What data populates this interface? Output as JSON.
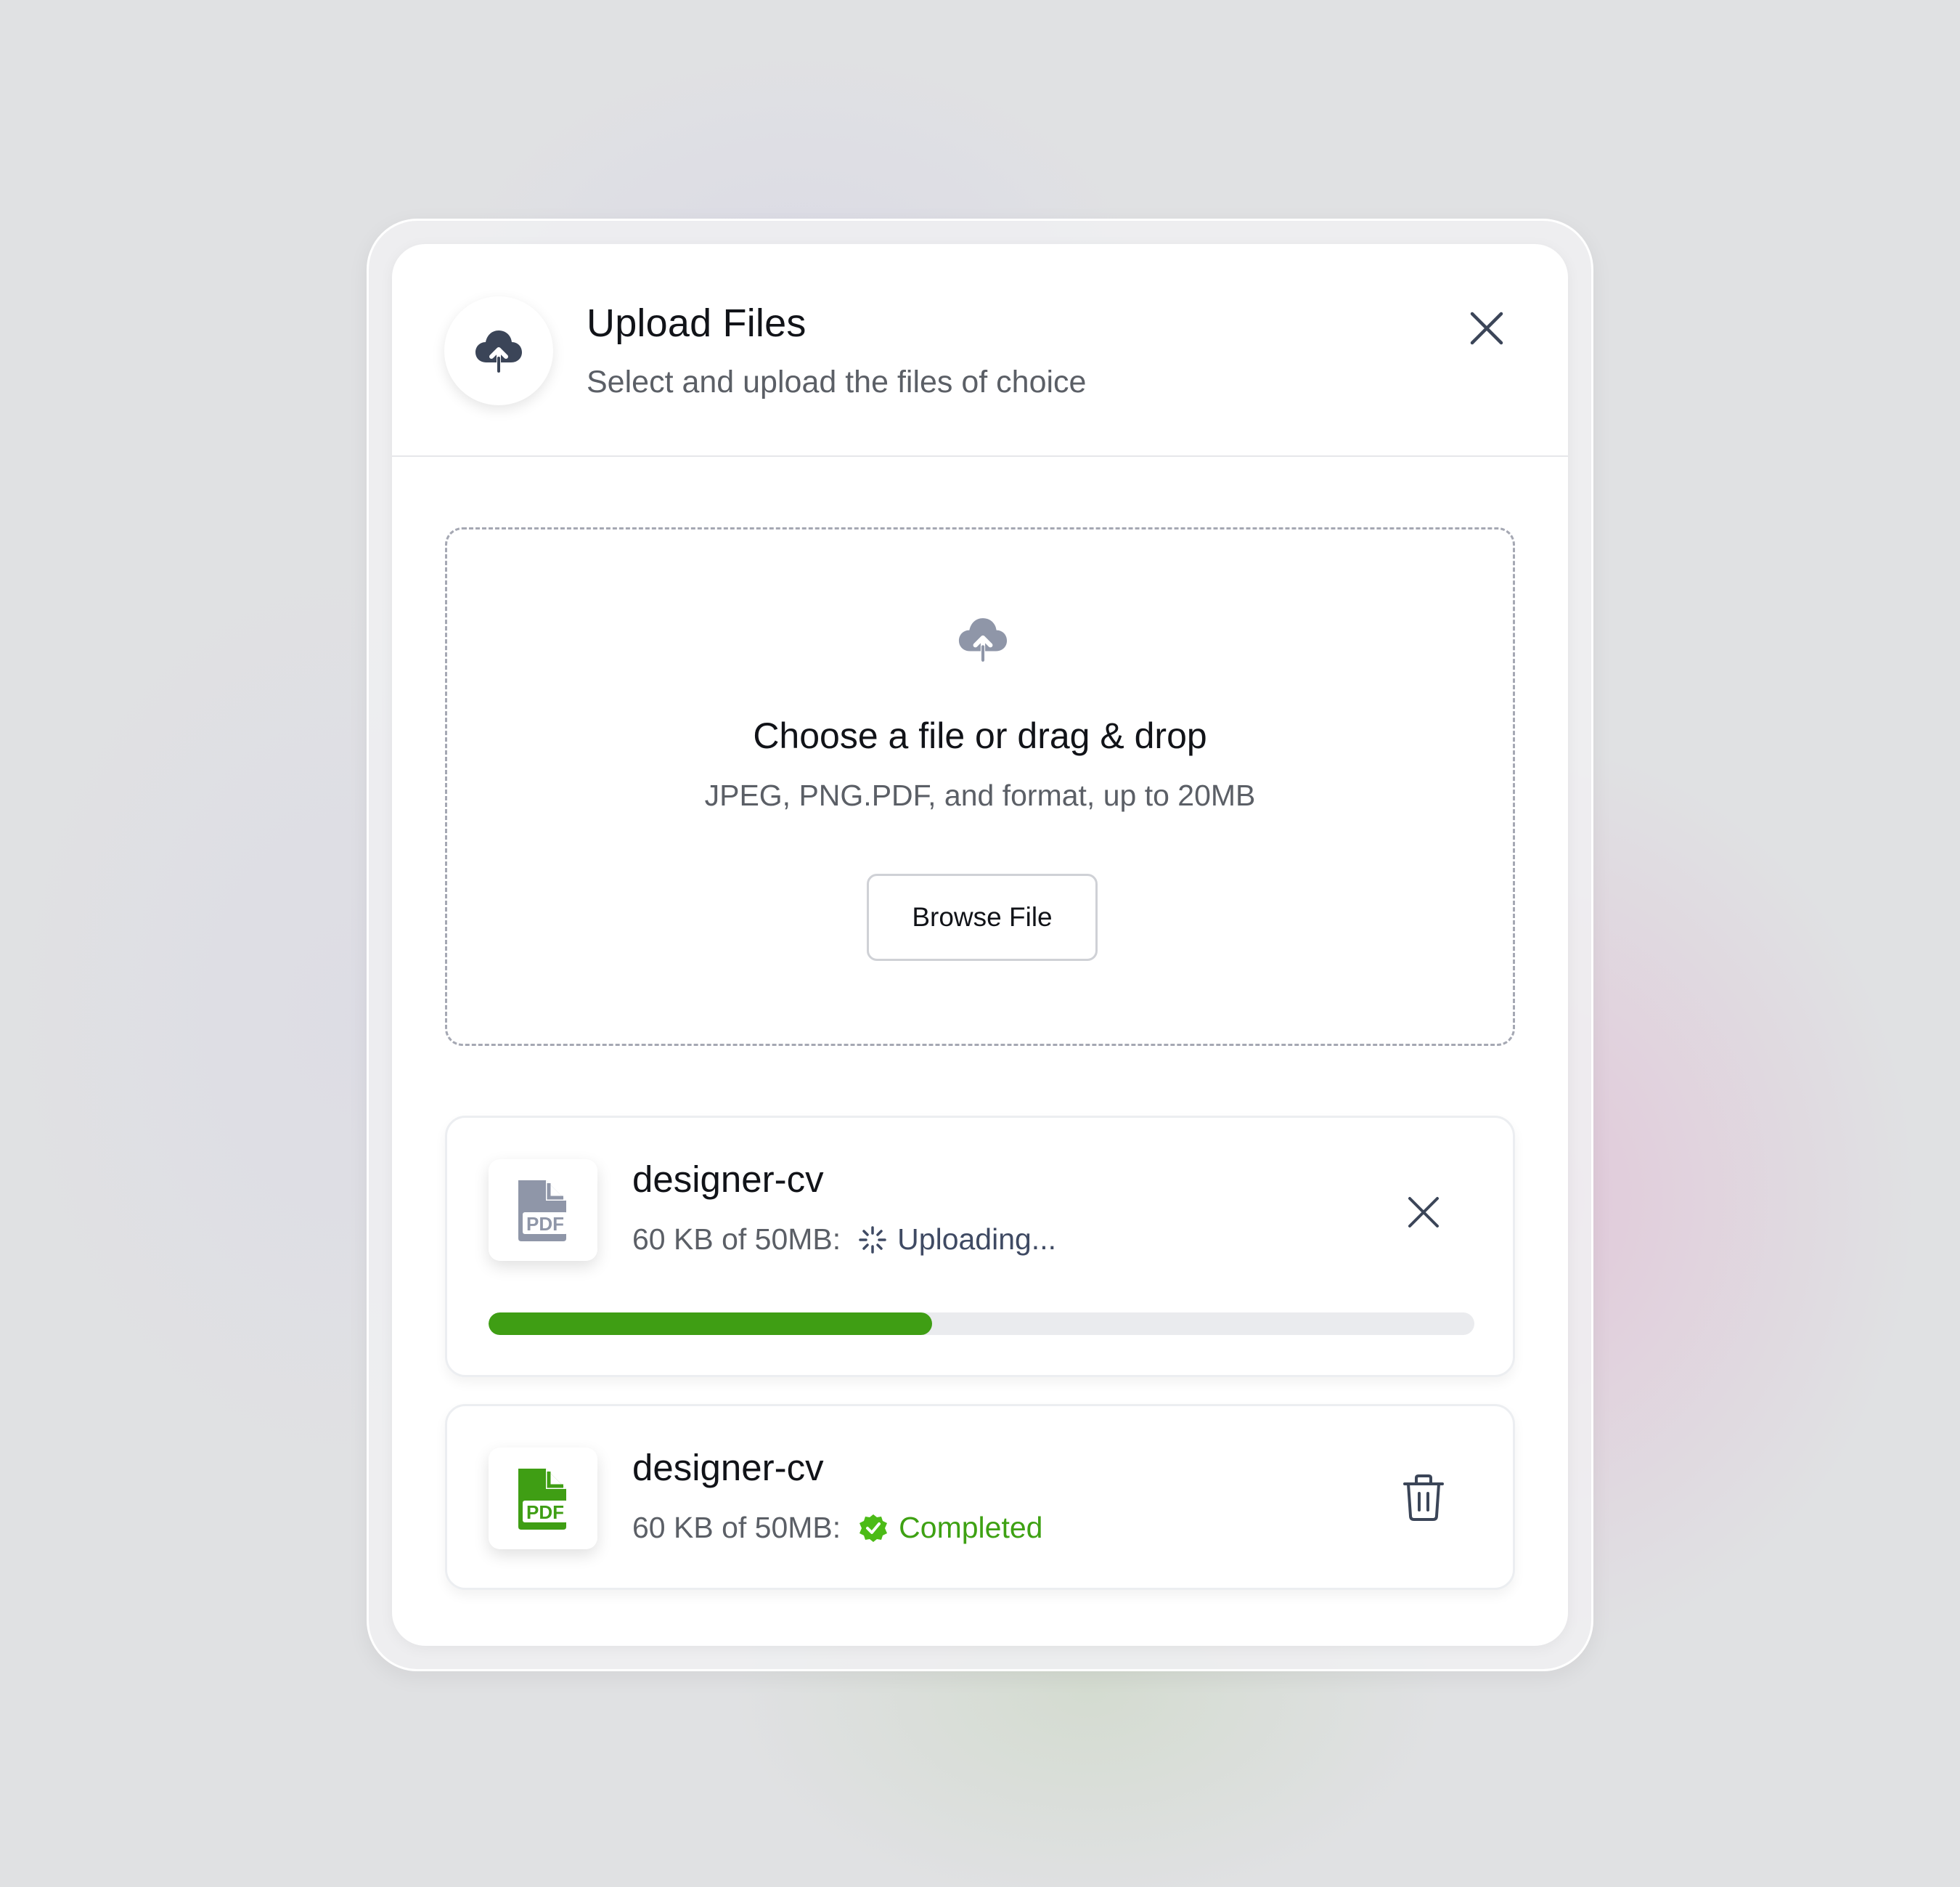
{
  "colors": {
    "accent_green": "#3f9e14",
    "completed_green": "#3ea113",
    "uploading_text": "#3f4a63",
    "icon_dark": "#3b4558",
    "icon_muted": "#8f96a8"
  },
  "header": {
    "icon": "cloud-upload-icon",
    "title": "Upload Files",
    "subtitle": "Select and upload the files of choice",
    "close_icon": "close-icon"
  },
  "dropzone": {
    "icon": "cloud-upload-icon",
    "title": "Choose a file or drag & drop",
    "hint": "JPEG, PNG.PDF, and format, up to 20MB",
    "browse_label": "Browse File"
  },
  "files": [
    {
      "name": "designer-cv",
      "size_text": "60 KB of 50MB:",
      "status": "Uploading...",
      "status_icon": "spinner-icon",
      "file_icon": "pdf-file-icon",
      "action_icon": "close-icon",
      "progress": 0.45
    },
    {
      "name": "designer-cv",
      "size_text": "60 KB of 50MB:",
      "status": "Completed",
      "status_icon": "verified-check-icon",
      "file_icon": "pdf-file-icon",
      "action_icon": "trash-icon"
    }
  ]
}
